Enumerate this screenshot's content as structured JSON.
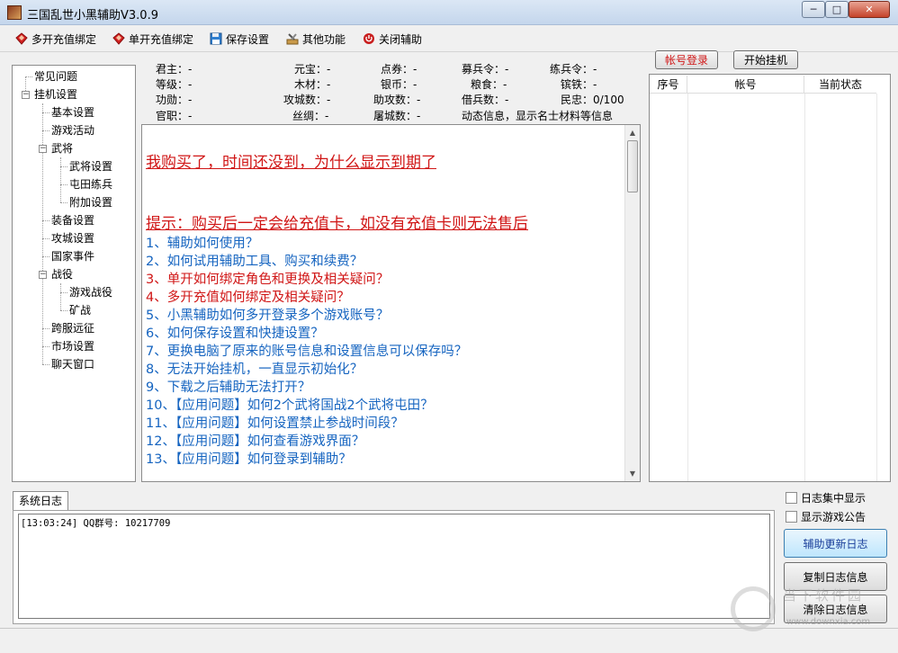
{
  "window": {
    "title": "三国乱世小黑辅助V3.0.9",
    "min": "─",
    "max": "□",
    "close": "✕"
  },
  "toolbar": {
    "items": [
      {
        "label": "多开充值绑定",
        "icon": "red-gem-icon"
      },
      {
        "label": "单开充值绑定",
        "icon": "red-gem-icon"
      },
      {
        "label": "保存设置",
        "icon": "floppy-disk-icon"
      },
      {
        "label": "其他功能",
        "icon": "tools-icon"
      },
      {
        "label": "关闭辅助",
        "icon": "power-icon"
      }
    ]
  },
  "tree": {
    "items": [
      "常见问题",
      "挂机设置",
      "基本设置",
      "游戏活动",
      "武将",
      "武将设置",
      "屯田练兵",
      "附加设置",
      "装备设置",
      "攻城设置",
      "国家事件",
      "战役",
      "游戏战役",
      "矿战",
      "跨服远征",
      "市场设置",
      "聊天窗口"
    ]
  },
  "info": {
    "junzhu": "君主：-",
    "yuanbao": "元宝：-",
    "dianquan": "点券：-",
    "mubingling": "募兵令：-",
    "lianbingling": "练兵令：-",
    "dengji": "等级：-",
    "mucai": "木材：-",
    "yinbi": "银币：-",
    "liangshi": "粮食：-",
    "bintie": "镔铁：-",
    "gongxun": "功勋：-",
    "gongchengshu": "攻城数：-",
    "zhugongshu": "助攻数：-",
    "jiebingshu": "借兵数：-",
    "minzhong": "民忠：0/100",
    "guanzhi": "官职：-",
    "sichou": "丝绸：-",
    "tuchengshu": "屠城数：-",
    "dongtai": "动态信息，显示名士材料等信息"
  },
  "faq": {
    "headline1": "我购买了，时间还没到，为什么显示到期了",
    "headline2": "提示：购买后一定会给充值卡，如没有充值卡则无法售后",
    "items": [
      "1、辅助如何使用？",
      "2、如何试用辅助工具、购买和续费？",
      "3、单开如何绑定角色和更换及相关疑问？",
      "4、多开充值如何绑定及相关疑问？",
      "5、小黑辅助如何多开登录多个游戏账号？",
      "6、如何保存设置和快捷设置？",
      "7、更换电脑了原来的账号信息和设置信息可以保存吗？",
      "8、无法开始挂机，一直显示初始化？",
      "9、下载之后辅助无法打开？",
      "10、【应用问题】如何2个武将国战2个武将屯田？",
      "11、【应用问题】如何设置禁止参战时间段？",
      "12、【应用问题】如何查看游戏界面？",
      "13、【应用问题】如何登录到辅助？"
    ]
  },
  "accounts": {
    "login_btn": "帐号登录",
    "start_btn": "开始挂机",
    "col_no": "序号",
    "col_account": "帐号",
    "col_status": "当前状态"
  },
  "log": {
    "tab": "系统日志",
    "line": "[13:03:24] QQ群号: 10217709"
  },
  "options": {
    "concentrate": "日志集中显示",
    "announce": "显示游戏公告"
  },
  "logbtns": {
    "update": "辅助更新日志",
    "copy": "复制日志信息",
    "clear": "清除日志信息"
  },
  "watermark": {
    "site": "www.downxia.com",
    "brand": "当下软件园"
  }
}
